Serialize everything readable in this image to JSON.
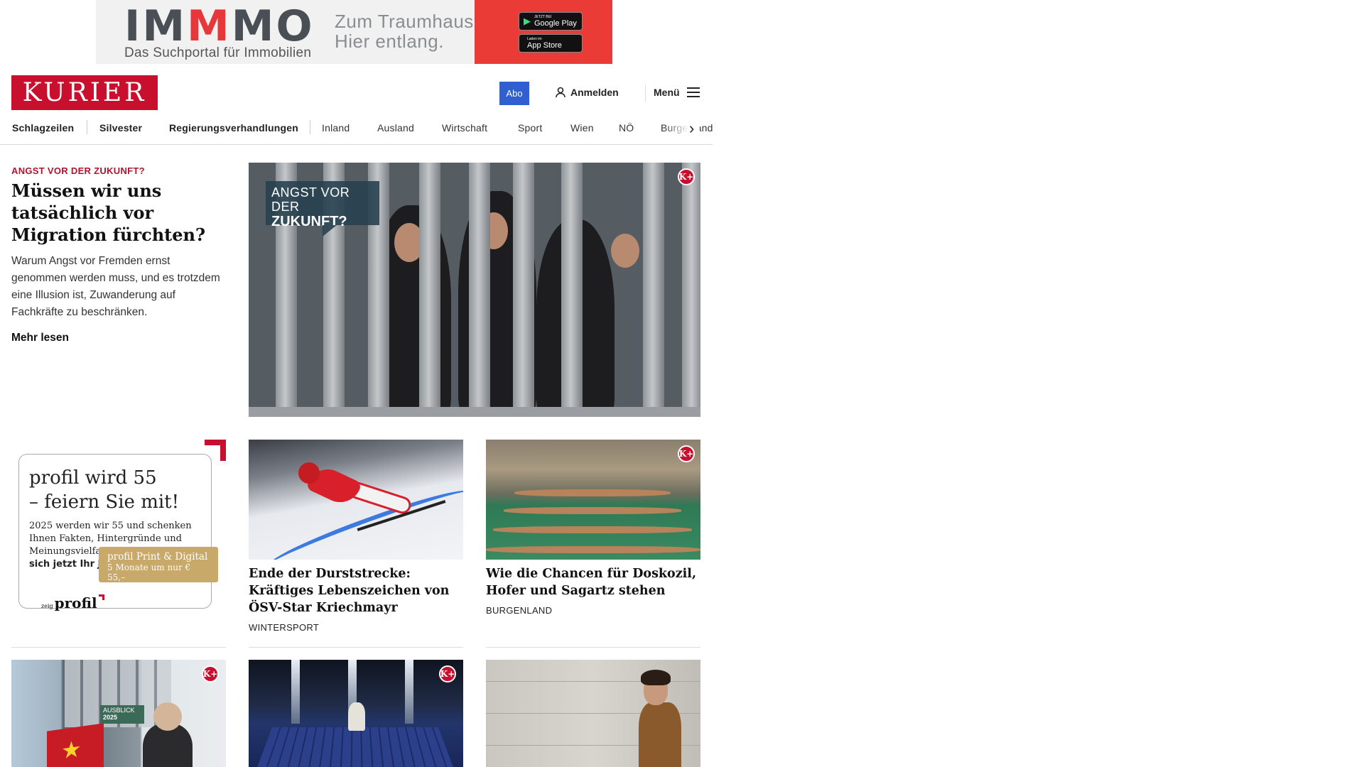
{
  "ad": {
    "logo_part1": "IM",
    "logo_part2": "M",
    "logo_part3": "MO",
    "tagline": "Das Suchportal für Immobilien",
    "slogan_line1": "Zum Traumhaus?",
    "slogan_line2": "Hier entlang.",
    "google_small": "JETZT BEI",
    "google_large": "Google Play",
    "apple_small": "Laden im",
    "apple_large": "App Store"
  },
  "header": {
    "logo_text": "KURIER",
    "abo_label": "Abo",
    "login_label": "Anmelden",
    "menu_label": "Menü"
  },
  "nav": {
    "items": [
      "Schlagzeilen",
      "Silvester",
      "Regierungsverhandlungen",
      "Inland",
      "Ausland",
      "Wirtschaft",
      "Sport",
      "Wien",
      "NÖ",
      "Burgenland"
    ]
  },
  "lead": {
    "kicker": "ANGST VOR DER ZUKUNFT?",
    "title": "Müssen wir uns tatsäch­lich vor Migration fürchten?",
    "teaser": "Warum Angst vor Fremden ernst genommen werden muss, und es trotzdem eine Illusion ist, Zuwanderung auf Fachkräfte zu beschränken.",
    "read_more": "Mehr lesen",
    "image_label_line1": "ANGST VOR DER",
    "image_label_line2": "ZUKUNFT?",
    "plus_badge": "K+"
  },
  "profil_ad": {
    "headline_line1": "profil wird 55",
    "headline_line2": "– feiern Sie mit!",
    "body": "2025 werden wir 55 und schenken Ihnen Fakten, Hintergründe und Meinungsvielfalt.",
    "body_bold": "Sichern Sie sich jetzt Ihr Jubiläumsabo!",
    "badge_line1": "profil Print & Digital",
    "badge_line2": "5 Monate um nur € 55,–",
    "logo_small": "zeig",
    "logo_text": "profil"
  },
  "articles": [
    {
      "title": "Ende der Durststrecke: Kräftiges Lebenszeichen von ÖSV-Star Kriechmayr",
      "category": "WINTERSPORT"
    },
    {
      "title": "Wie die Chancen für Doskozil, Ho­fer und Sagartz stehen",
      "category": "BURGENLAND",
      "plus_badge": "K+"
    }
  ],
  "bottom_row": {
    "eco_tag_line1": "AUSBLICK",
    "eco_tag_line2": "2025",
    "eco_badge": "K+",
    "solar_badge": "K+"
  }
}
